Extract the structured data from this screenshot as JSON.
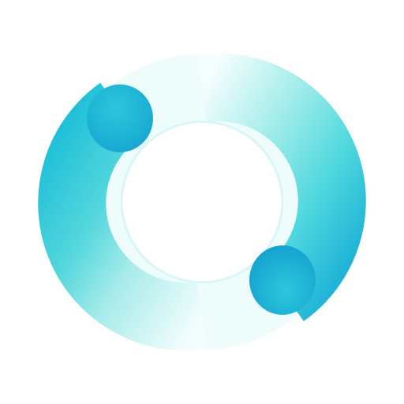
{
  "logo": {
    "icon": "ring-logo-icon",
    "colors": {
      "background": "#ffffff",
      "ring_light": "#e9fbfb",
      "ring_mid": "#7ee3e2",
      "ring_main": "#45d3d8",
      "cap_dark": "#1fb2d6",
      "cap_light": "#2cc3d8",
      "inner_shadow": "#c6f0f2"
    }
  }
}
